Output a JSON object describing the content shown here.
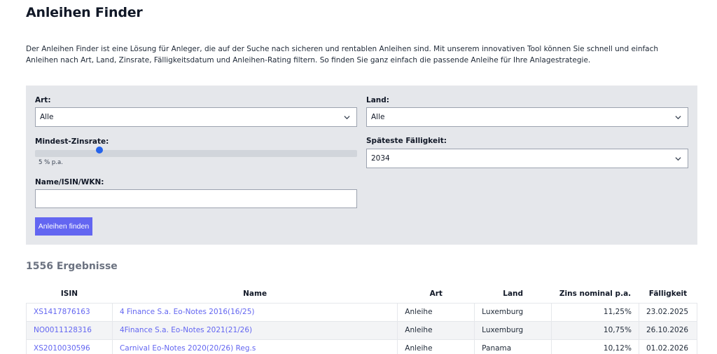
{
  "page": {
    "title": "Anleihen Finder",
    "intro": "Der Anleihen Finder ist eine Lösung für Anleger, die auf der Suche nach sicheren und rentablen Anleihen sind. Mit unserem innovativen Tool können Sie schnell und einfach Anleihen nach Art, Land, Zinsrate, Fälligkeitsdatum und Anleihen-Rating filtern. So finden Sie ganz einfach die passende Anleihe für Ihre Anlagestrategie."
  },
  "filters": {
    "art_label": "Art:",
    "art_value": "Alle",
    "land_label": "Land:",
    "land_value": "Alle",
    "zins_label": "Mindest-Zinsrate:",
    "zins_value_text": "5 % p.a.",
    "zins_fraction": 0.2,
    "faelligkeit_label": "Späteste Fälligkeit:",
    "faelligkeit_value": "2034",
    "name_label": "Name/ISIN/WKN:",
    "name_value": "",
    "submit_label": "Anleihen finden"
  },
  "results": {
    "count_text": "1556 Ergebnisse",
    "columns": [
      "ISIN",
      "Name",
      "Art",
      "Land",
      "Zins nominal p.a.",
      "Fälligkeit"
    ],
    "rows": [
      {
        "isin": "XS1417876163",
        "name": "4 Finance S.a. Eo-Notes 2016(16/25)",
        "art": "Anleihe",
        "land": "Luxemburg",
        "zins": "11,25%",
        "faelligkeit": "23.02.2025"
      },
      {
        "isin": "NO0011128316",
        "name": "4Finance S.a. Eo-Notes 2021(21/26)",
        "art": "Anleihe",
        "land": "Luxemburg",
        "zins": "10,75%",
        "faelligkeit": "26.10.2026"
      },
      {
        "isin": "XS2010030596",
        "name": "Carnival Eo-Notes 2020(20/26) Reg.s",
        "art": "Anleihe",
        "land": "Panama",
        "zins": "10,12%",
        "faelligkeit": "01.02.2026"
      }
    ]
  },
  "colors": {
    "accent": "#6366f1",
    "slider_thumb": "#2563eb",
    "panel_bg": "#e5e7eb"
  }
}
